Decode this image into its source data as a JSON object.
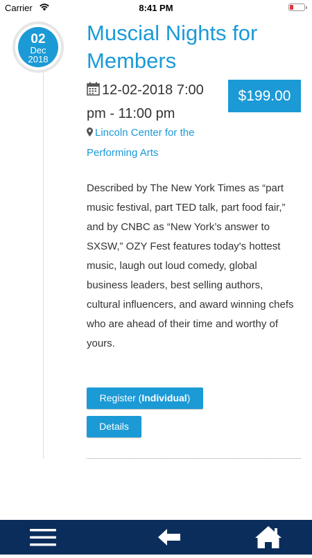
{
  "status_bar": {
    "carrier": "Carrier",
    "time": "8:41 PM",
    "wifi_icon": "wifi-icon",
    "battery_icon": "battery-icon",
    "battery_color": "#e0363e"
  },
  "event": {
    "date": {
      "day": "02",
      "month": "Dec",
      "year": "2018"
    },
    "title": "Muscial Nights for Members",
    "price": "$199.00",
    "datetime": "12-02-2018  7:00 pm - 11:00 pm",
    "location": "Lincoln Center for the Performing Arts",
    "description": "Described by The New York Times as “part music festival, part TED talk, part food fair,” and by CNBC as “New York’s answer to SXSW,” OZY Fest features today's hottest music, laugh out loud comedy, global business leaders, best selling authors, cultural influencers, and award winning chefs who are ahead of their time and worthy of yours.",
    "register_prefix": "Register (",
    "register_bold": "Individual",
    "register_suffix": ")",
    "details_label": "Details"
  },
  "bottom_nav": {
    "items": [
      {
        "icon": "menu-icon"
      },
      {
        "icon": "back-arrow-icon"
      },
      {
        "icon": "home-icon"
      }
    ],
    "background": "#0b2d5c"
  },
  "colors": {
    "accent": "#1b9ad6",
    "text": "#333333"
  }
}
